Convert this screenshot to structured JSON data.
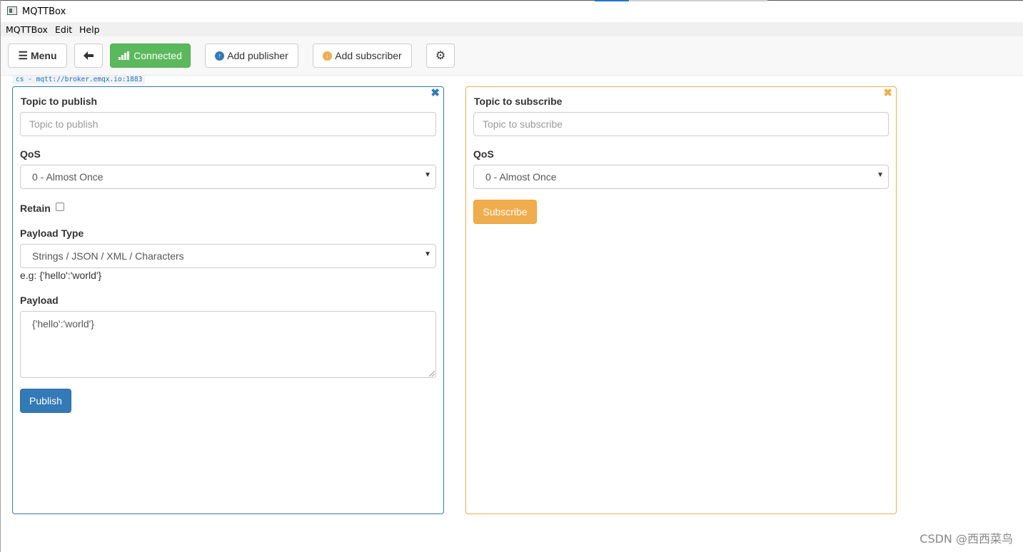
{
  "window": {
    "title": "MQTTBox"
  },
  "menubar": [
    "MQTTBox",
    "Edit",
    "Help"
  ],
  "toolbar": {
    "menu_label": "Menu",
    "connected_label": "Connected",
    "add_publisher_label": "Add publisher",
    "add_subscriber_label": "Add subscriber"
  },
  "connection": {
    "label": "cs - mqtt://broker.emqx.io:1883"
  },
  "publisher": {
    "topic_label": "Topic to publish",
    "topic_placeholder": "Topic to publish",
    "qos_label": "QoS",
    "qos_value": "0 - Almost Once",
    "retain_label": "Retain",
    "retain_checked": false,
    "payload_type_label": "Payload Type",
    "payload_type_value": "Strings / JSON / XML / Characters",
    "payload_example": "e.g: {'hello':'world'}",
    "payload_label": "Payload",
    "payload_value": "{'hello':'world'}",
    "publish_label": "Publish",
    "accent_color": "#337ab7"
  },
  "subscriber": {
    "topic_label": "Topic to subscribe",
    "topic_placeholder": "Topic to subscribe",
    "qos_label": "QoS",
    "qos_value": "0 - Almost Once",
    "subscribe_label": "Subscribe",
    "accent_color": "#f0ad4e"
  },
  "watermark": "CSDN @西西菜鸟",
  "icons": [
    "hamburger-icon",
    "arrow-left-icon",
    "signal-icon",
    "arrow-up-circle-icon",
    "arrow-down-circle-icon",
    "gear-icon",
    "close-icon",
    "caret-down-icon"
  ]
}
